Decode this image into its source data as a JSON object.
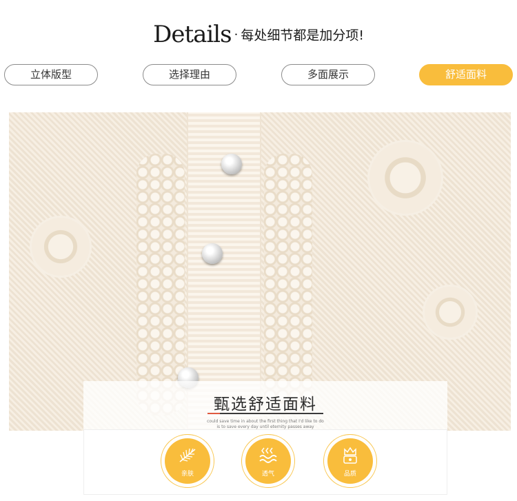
{
  "header": {
    "title_en": "Details",
    "separator": "·",
    "title_cn": "每处细节都是加分项!"
  },
  "tabs": [
    {
      "label": "立体版型",
      "active": false
    },
    {
      "label": "选择理由",
      "active": false
    },
    {
      "label": "多面展示",
      "active": false
    },
    {
      "label": "舒适面料",
      "active": true
    }
  ],
  "colors": {
    "accent": "#f9bd3c",
    "tab_border": "#8a8a8a",
    "fabric": "#f3e9da"
  },
  "overlay": {
    "title": "甄选舒适面料",
    "subtext_line1": "could save time in about the first thing that I'd like to do",
    "subtext_line2": "is to save every day until eternity passes away"
  },
  "features": [
    {
      "label": "亲肤",
      "icon": "leaf-icon"
    },
    {
      "label": "透气",
      "icon": "waves-icon"
    },
    {
      "label": "品质",
      "icon": "crown-icon"
    }
  ]
}
